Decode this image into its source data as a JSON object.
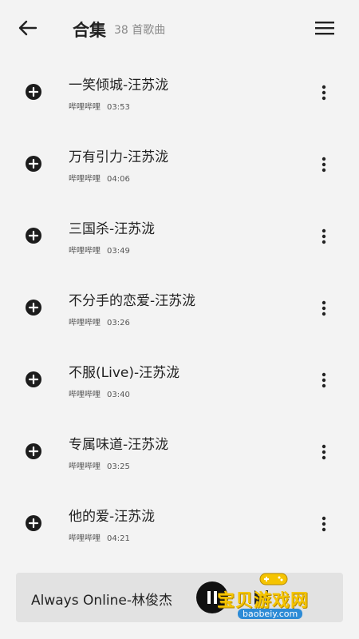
{
  "header": {
    "title": "合集",
    "count": "38 首歌曲"
  },
  "songs": [
    {
      "title": "一笑倾城-汪苏泷",
      "source": "哔哩哔哩",
      "duration": "03:53"
    },
    {
      "title": "万有引力-汪苏泷",
      "source": "哔哩哔哩",
      "duration": "04:06"
    },
    {
      "title": "三国杀-汪苏泷",
      "source": "哔哩哔哩",
      "duration": "03:49"
    },
    {
      "title": "不分手的恋爱-汪苏泷",
      "source": "哔哩哔哩",
      "duration": "03:26"
    },
    {
      "title": "不服(Live)-汪苏泷",
      "source": "哔哩哔哩",
      "duration": "03:40"
    },
    {
      "title": "专属味道-汪苏泷",
      "source": "哔哩哔哩",
      "duration": "03:25"
    },
    {
      "title": "他的爱-汪苏泷",
      "source": "哔哩哔哩",
      "duration": "04:21"
    }
  ],
  "player": {
    "now_playing": "Always Online-林俊杰",
    "state": "playing"
  },
  "watermark": {
    "text": "宝贝游戏网",
    "url": "baobeiy.com"
  },
  "icons": {
    "back": "arrow-left-icon",
    "menu": "hamburger-menu-icon",
    "add": "plus-circle-icon",
    "more": "more-vertical-icon",
    "pause": "pause-icon",
    "next": "skip-next-icon"
  },
  "colors": {
    "background": "#f3f3f3",
    "player_bar": "#e2e2e2",
    "watermark_yellow": "#f5c400",
    "watermark_blue": "#2d8bd6"
  }
}
